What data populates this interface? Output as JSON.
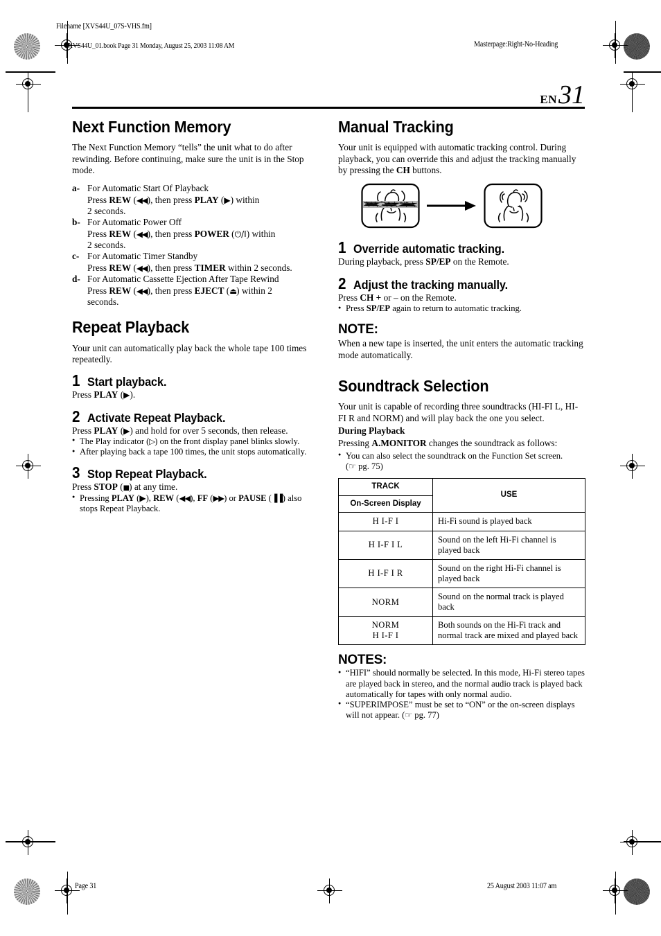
{
  "page_meta": {
    "filename_label": "Filename [XVS44U_07S-VHS.fm]",
    "book_line": "XVS44U_01.book  Page 31  Monday, August 25, 2003  11:08 AM",
    "masterpage": "Masterpage:Right-No-Heading",
    "footer_page": "Page 31",
    "footer_timestamp": "25 August 2003 11:07 am"
  },
  "folio": {
    "language": "EN",
    "page_number": "31"
  },
  "left_column": {
    "next_function_memory": {
      "heading": "Next Function Memory",
      "intro": "The Next Function Memory “tells” the unit what to do after rewinding. Before continuing, make sure the unit is in the Stop mode.",
      "items": [
        {
          "key": "a-",
          "line1": "For Automatic Start Of Playback",
          "line2_pre": "Press ",
          "line2_b1": "REW",
          "line2_sym1": "◀◀",
          "line2_mid": ", then press ",
          "line2_b2": "PLAY",
          "line2_sym2": "▶",
          "line2_post": " within",
          "line3": "2 seconds."
        },
        {
          "key": "b-",
          "line1": "For Automatic Power Off",
          "line2_pre": "Press ",
          "line2_b1": "REW",
          "line2_sym1": "◀◀",
          "line2_mid": ", then press ",
          "line2_b2": "POWER",
          "line2_sym2": "⏻/I",
          "line2_post": " within",
          "line3": "2 seconds."
        },
        {
          "key": "c-",
          "line1": "For Automatic Timer Standby",
          "line2_pre": "Press ",
          "line2_b1": "REW",
          "line2_sym1": "◀◀",
          "line2_mid": ", then press ",
          "line2_b2": "TIMER",
          "line2_sym2": "",
          "line2_post": " within 2 seconds.",
          "line3": ""
        },
        {
          "key": "d-",
          "line1": "For Automatic Cassette Ejection After Tape Rewind",
          "line2_pre": "Press ",
          "line2_b1": "REW",
          "line2_sym1": "◀◀",
          "line2_mid": ", then press ",
          "line2_b2": "EJECT",
          "line2_sym2": "⏏",
          "line2_post": " within 2",
          "line3": "seconds."
        }
      ]
    },
    "repeat_playback": {
      "heading": "Repeat Playback",
      "intro": "Your unit can automatically play back the whole tape 100 times repeatedly.",
      "step1": {
        "num": "1",
        "title": "Start playback.",
        "body_pre": "Press ",
        "body_b": "PLAY",
        "body_sym": "▶",
        "body_post": ")."
      },
      "step2": {
        "num": "2",
        "title": "Activate Repeat Playback.",
        "body_pre": "Press ",
        "body_b": "PLAY",
        "body_sym": "▶",
        "body_post": ") and hold for over 5 seconds, then release.",
        "bullet1_pre": "The Play indicator (",
        "bullet1_sym": "▷",
        "bullet1_post": ") on the front display panel blinks slowly.",
        "bullet2": "After playing back a tape 100 times, the unit stops automatically."
      },
      "step3": {
        "num": "3",
        "title": "Stop Repeat Playback.",
        "body_pre": "Press ",
        "body_b": "STOP",
        "body_sym": "■",
        "body_post": ") at any time.",
        "bullet_pre": "Pressing ",
        "bullet_b1": "PLAY",
        "bullet_s1": "▶",
        "bullet_b2": "REW",
        "bullet_s2": "◀◀",
        "bullet_b3": "FF",
        "bullet_s3": "▶▶",
        "bullet_or": " or ",
        "bullet_b4": "PAUSE",
        "bullet_s4": "▐▐",
        "bullet_post": ") also stops Repeat Playback."
      }
    }
  },
  "right_column": {
    "manual_tracking": {
      "heading": "Manual Tracking",
      "intro_pre": "Your unit is equipped with automatic tracking control. During playback, you can override this and adjust the tracking manually by pressing the ",
      "intro_b": "CH",
      "intro_post": " buttons.",
      "illustration": {
        "left_label": "tv-screen-with-tracking-noise",
        "arrow": "arrow-right",
        "right_label": "tv-screen-clean"
      },
      "step1": {
        "num": "1",
        "title": "Override automatic tracking.",
        "body_pre": "During playback, press ",
        "body_b": "SP/EP",
        "body_post": " on the Remote."
      },
      "step2": {
        "num": "2",
        "title": "Adjust the tracking manually.",
        "body_pre": "Press ",
        "body_b": "CH +",
        "body_post": " or – on the Remote.",
        "bullet_pre": "Press ",
        "bullet_b": "SP/EP",
        "bullet_post": " again to return to automatic tracking."
      },
      "note_heading": "NOTE:",
      "note_body": "When a new tape is inserted, the unit enters the automatic tracking mode automatically."
    },
    "soundtrack_selection": {
      "heading": "Soundtrack Selection",
      "intro": "Your unit is capable of recording three soundtracks (HI-FI L, HI-FI R and NORM) and will play back the one you select.",
      "during_playback_head": "During Playback",
      "pressing_pre": "Pressing ",
      "pressing_b": "A.MONITOR",
      "pressing_post": " changes the soundtrack as follows:",
      "bullet_text": "You can also select the soundtrack on the Function Set screen.",
      "bullet_ref_hand": "☞",
      "bullet_ref_text": "pg. 75",
      "table": {
        "head_track": "TRACK",
        "head_osd": "On-Screen Display",
        "head_use": "USE",
        "rows": [
          {
            "code": "H I-F I",
            "use": "Hi-Fi sound is played back"
          },
          {
            "code": "H I-F I L",
            "use": "Sound on the left Hi-Fi channel is played back"
          },
          {
            "code": "H I-F I R",
            "use": "Sound on the right Hi-Fi channel is played back"
          },
          {
            "code": "NORM",
            "use": "Sound on the normal track is played back"
          },
          {
            "code": "NORM\nH I-F I",
            "use": "Both sounds on the Hi-Fi track and normal track are mixed and played back"
          }
        ]
      },
      "notes_heading": "NOTES:",
      "note1": "“HIFI” should normally be selected. In this mode, Hi-Fi stereo tapes are played back in stereo, and the normal audio track is played back automatically for tapes with only normal audio.",
      "note2_pre": "“SUPERIMPOSE” must be set to “ON” or the on-screen displays will not appear. (",
      "note2_hand": "☞",
      "note2_ref": "pg. 77",
      "note2_post": ")"
    }
  }
}
